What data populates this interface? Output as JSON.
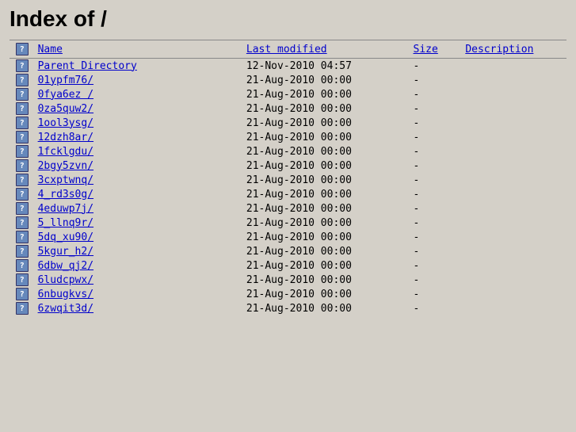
{
  "page": {
    "title": "Index of /",
    "heading": "Index of /"
  },
  "table": {
    "headers": {
      "name": "Name",
      "modified": "Last modified",
      "size": "Size",
      "description": "Description"
    },
    "rows": [
      {
        "name": "Parent Directory",
        "modified": "12-Nov-2010 04:57",
        "size": "-",
        "desc": ""
      },
      {
        "name": "01ypfm76/",
        "modified": "21-Aug-2010 00:00",
        "size": "-",
        "desc": ""
      },
      {
        "name": "0fya6ez /",
        "modified": "21-Aug-2010 00:00",
        "size": "-",
        "desc": ""
      },
      {
        "name": "0za5quw2/",
        "modified": "21-Aug-2010 00:00",
        "size": "-",
        "desc": ""
      },
      {
        "name": "1ool3ysg/",
        "modified": "21-Aug-2010 00:00",
        "size": "-",
        "desc": ""
      },
      {
        "name": "12dzh8ar/",
        "modified": "21-Aug-2010 00:00",
        "size": "-",
        "desc": ""
      },
      {
        "name": "1fcklgdu/",
        "modified": "21-Aug-2010 00:00",
        "size": "-",
        "desc": ""
      },
      {
        "name": "2bgy5zvn/",
        "modified": "21-Aug-2010 00:00",
        "size": "-",
        "desc": ""
      },
      {
        "name": "3cxptwnq/",
        "modified": "21-Aug-2010 00:00",
        "size": "-",
        "desc": ""
      },
      {
        "name": "4_rd3s0g/",
        "modified": "21-Aug-2010 00:00",
        "size": "-",
        "desc": ""
      },
      {
        "name": "4eduwp7j/",
        "modified": "21-Aug-2010 00:00",
        "size": "-",
        "desc": ""
      },
      {
        "name": "5_llnq9r/",
        "modified": "21-Aug-2010 00:00",
        "size": "-",
        "desc": ""
      },
      {
        "name": "5dq_xu90/",
        "modified": "21-Aug-2010 00:00",
        "size": "-",
        "desc": ""
      },
      {
        "name": "5kgur_h2/",
        "modified": "21-Aug-2010 00:00",
        "size": "-",
        "desc": ""
      },
      {
        "name": "6dbw_qj2/",
        "modified": "21-Aug-2010 00:00",
        "size": "-",
        "desc": ""
      },
      {
        "name": "6ludcpwx/",
        "modified": "21-Aug-2010 00:00",
        "size": "-",
        "desc": ""
      },
      {
        "name": "6nbugkvs/",
        "modified": "21-Aug-2010 00:00",
        "size": "-",
        "desc": ""
      },
      {
        "name": "6zwqit3d/",
        "modified": "21-Aug-2010 00:00",
        "size": "-",
        "desc": ""
      }
    ]
  },
  "icon": {
    "label": "?"
  }
}
